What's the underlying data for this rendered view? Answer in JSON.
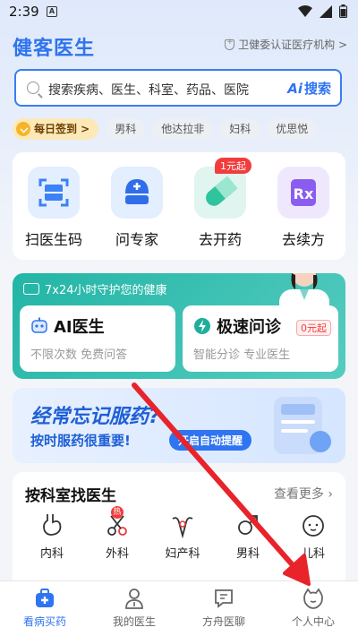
{
  "status_bar": {
    "time": "2:39",
    "notif": "A"
  },
  "header": {
    "title": "健客医生",
    "cert_label": "卫健委认证医疗机构 >"
  },
  "search": {
    "placeholder": "搜索疾病、医生、科室、药品、医院",
    "button_label": "搜索",
    "button_ai": "Ai"
  },
  "tags": {
    "signin": "每日签到 >",
    "items": [
      "男科",
      "他达拉非",
      "妇科",
      "优思悦"
    ]
  },
  "quick_actions": [
    {
      "label": "扫医生码",
      "icon": "scan-code-icon"
    },
    {
      "label": "问专家",
      "icon": "nurse-cap-icon"
    },
    {
      "label": "去开药",
      "icon": "pill-icon",
      "badge": "1元起"
    },
    {
      "label": "去续方",
      "icon": "rx-icon"
    }
  ],
  "ai_card": {
    "headline": "7x24小时守护您的健康",
    "left": {
      "title": "AI医生",
      "desc": "不限次数 免费问答"
    },
    "right": {
      "title": "极速问诊",
      "desc": "智能分诊 专业医生",
      "price": "0元起"
    }
  },
  "banner": {
    "line1": "经常忘记服药?",
    "line2": "按时服药很重要!",
    "button": "开启自动提醒"
  },
  "departments": {
    "title": "按科室找医生",
    "more": "查看更多 ›",
    "hot_badge": "热",
    "items": [
      {
        "label": "内科",
        "icon": "stomach-icon"
      },
      {
        "label": "外科",
        "icon": "scissors-icon"
      },
      {
        "label": "妇产科",
        "icon": "uterus-icon"
      },
      {
        "label": "男科",
        "icon": "male-icon"
      },
      {
        "label": "儿科",
        "icon": "baby-icon"
      }
    ]
  },
  "tabbar": [
    {
      "label": "看病买药",
      "icon": "medical-bag-icon",
      "active": true
    },
    {
      "label": "我的医生",
      "icon": "doctor-icon",
      "active": false
    },
    {
      "label": "方舟医聊",
      "icon": "chat-icon",
      "active": false
    },
    {
      "label": "个人中心",
      "icon": "profile-icon",
      "active": false
    }
  ],
  "colors": {
    "brand": "#2f74f0",
    "teal": "#22b5a6",
    "red": "#f23c3c",
    "annotation_arrow": "#e8232a"
  }
}
